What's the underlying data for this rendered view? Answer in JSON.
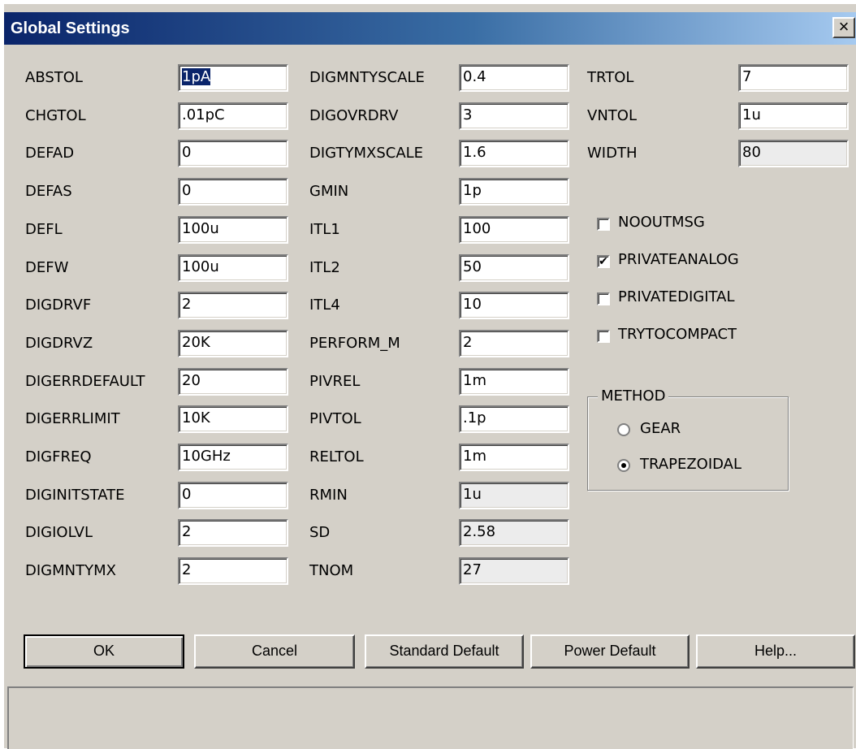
{
  "window": {
    "title": "Global Settings",
    "close_label": "×"
  },
  "col1": [
    {
      "label": "ABSTOL",
      "value": "1pA",
      "selected": true
    },
    {
      "label": "CHGTOL",
      "value": ".01pC"
    },
    {
      "label": "DEFAD",
      "value": "0"
    },
    {
      "label": "DEFAS",
      "value": "0"
    },
    {
      "label": "DEFL",
      "value": "100u"
    },
    {
      "label": "DEFW",
      "value": "100u"
    },
    {
      "label": "DIGDRVF",
      "value": "2"
    },
    {
      "label": "DIGDRVZ",
      "value": "20K"
    },
    {
      "label": "DIGERRDEFAULT",
      "value": "20"
    },
    {
      "label": "DIGERRLIMIT",
      "value": "10K"
    },
    {
      "label": "DIGFREQ",
      "value": "10GHz"
    },
    {
      "label": "DIGINITSTATE",
      "value": "0"
    },
    {
      "label": "DIGIOLVL",
      "value": "2"
    },
    {
      "label": "DIGMNTYMX",
      "value": "2"
    }
  ],
  "col2": [
    {
      "label": "DIGMNTYSCALE",
      "value": "0.4"
    },
    {
      "label": "DIGOVRDRV",
      "value": "3"
    },
    {
      "label": "DIGTYMXSCALE",
      "value": "1.6"
    },
    {
      "label": "GMIN",
      "value": "1p"
    },
    {
      "label": "ITL1",
      "value": "100"
    },
    {
      "label": "ITL2",
      "value": "50"
    },
    {
      "label": "ITL4",
      "value": "10"
    },
    {
      "label": "PERFORM_M",
      "value": "2"
    },
    {
      "label": "PIVREL",
      "value": "1m"
    },
    {
      "label": "PIVTOL",
      "value": ".1p"
    },
    {
      "label": "RELTOL",
      "value": "1m"
    },
    {
      "label": "RMIN",
      "value": "1u"
    },
    {
      "label": "SD",
      "value": "2.58"
    },
    {
      "label": "TNOM",
      "value": "27"
    }
  ],
  "col3": [
    {
      "label": "TRTOL",
      "value": "7"
    },
    {
      "label": "VNTOL",
      "value": "1u"
    },
    {
      "label": "WIDTH",
      "value": "80"
    }
  ],
  "checkboxes": [
    {
      "label": "NOOUTMSG",
      "checked": false
    },
    {
      "label": "PRIVATEANALOG",
      "checked": true
    },
    {
      "label": "PRIVATEDIGITAL",
      "checked": false
    },
    {
      "label": "TRYTOCOMPACT",
      "checked": false
    }
  ],
  "method": {
    "legend": "METHOD",
    "options": [
      {
        "label": "GEAR",
        "selected": false
      },
      {
        "label": "TRAPEZOIDAL",
        "selected": true
      }
    ]
  },
  "buttons": {
    "ok": "OK",
    "cancel": "Cancel",
    "standard_default": "Standard Default",
    "power_default": "Power Default",
    "help": "Help..."
  }
}
